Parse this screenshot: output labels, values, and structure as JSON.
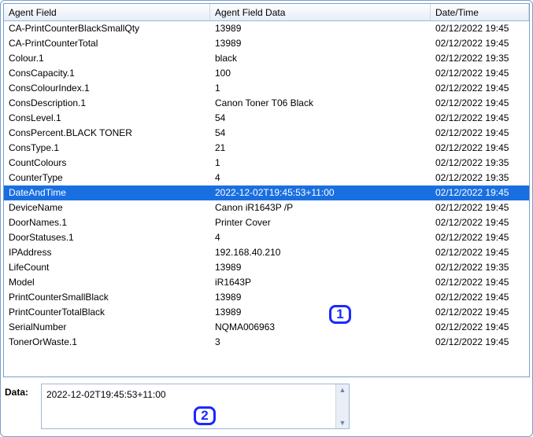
{
  "columns": {
    "field": "Agent Field",
    "data": "Agent Field Data",
    "date": "Date/Time"
  },
  "rows": [
    {
      "field": "CA-PrintCounterBlackSmallQty",
      "data": "13989",
      "date": "02/12/2022 19:45",
      "selected": false
    },
    {
      "field": "CA-PrintCounterTotal",
      "data": "13989",
      "date": "02/12/2022 19:45",
      "selected": false
    },
    {
      "field": "Colour.1",
      "data": "black",
      "date": "02/12/2022 19:35",
      "selected": false
    },
    {
      "field": "ConsCapacity.1",
      "data": "100",
      "date": "02/12/2022 19:45",
      "selected": false
    },
    {
      "field": "ConsColourIndex.1",
      "data": "1",
      "date": "02/12/2022 19:45",
      "selected": false
    },
    {
      "field": "ConsDescription.1",
      "data": "Canon Toner T06 Black",
      "date": "02/12/2022 19:45",
      "selected": false
    },
    {
      "field": "ConsLevel.1",
      "data": "54",
      "date": "02/12/2022 19:45",
      "selected": false
    },
    {
      "field": "ConsPercent.BLACK TONER",
      "data": "54",
      "date": "02/12/2022 19:45",
      "selected": false
    },
    {
      "field": "ConsType.1",
      "data": "21",
      "date": "02/12/2022 19:45",
      "selected": false
    },
    {
      "field": "CountColours",
      "data": "1",
      "date": "02/12/2022 19:35",
      "selected": false
    },
    {
      "field": "CounterType",
      "data": "4",
      "date": "02/12/2022 19:35",
      "selected": false
    },
    {
      "field": "DateAndTime",
      "data": "2022-12-02T19:45:53+11:00",
      "date": "02/12/2022 19:45",
      "selected": true
    },
    {
      "field": "DeviceName",
      "data": "Canon iR1643P /P",
      "date": "02/12/2022 19:45",
      "selected": false
    },
    {
      "field": "DoorNames.1",
      "data": "Printer Cover",
      "date": "02/12/2022 19:45",
      "selected": false
    },
    {
      "field": "DoorStatuses.1",
      "data": "4",
      "date": "02/12/2022 19:45",
      "selected": false
    },
    {
      "field": "IPAddress",
      "data": "192.168.40.210",
      "date": "02/12/2022 19:45",
      "selected": false
    },
    {
      "field": "LifeCount",
      "data": "13989",
      "date": "02/12/2022 19:35",
      "selected": false
    },
    {
      "field": "Model",
      "data": "iR1643P",
      "date": "02/12/2022 19:45",
      "selected": false
    },
    {
      "field": "PrintCounterSmallBlack",
      "data": "13989",
      "date": "02/12/2022 19:45",
      "selected": false
    },
    {
      "field": "PrintCounterTotalBlack",
      "data": "13989",
      "date": "02/12/2022 19:45",
      "selected": false
    },
    {
      "field": "SerialNumber",
      "data": "NQMA006963",
      "date": "02/12/2022 19:45",
      "selected": false
    },
    {
      "field": "TonerOrWaste.1",
      "data": "3",
      "date": "02/12/2022 19:45",
      "selected": false
    }
  ],
  "dataSection": {
    "label": "Data:",
    "value": "2022-12-02T19:45:53+11:00"
  },
  "callouts": {
    "one": "1",
    "two": "2"
  }
}
